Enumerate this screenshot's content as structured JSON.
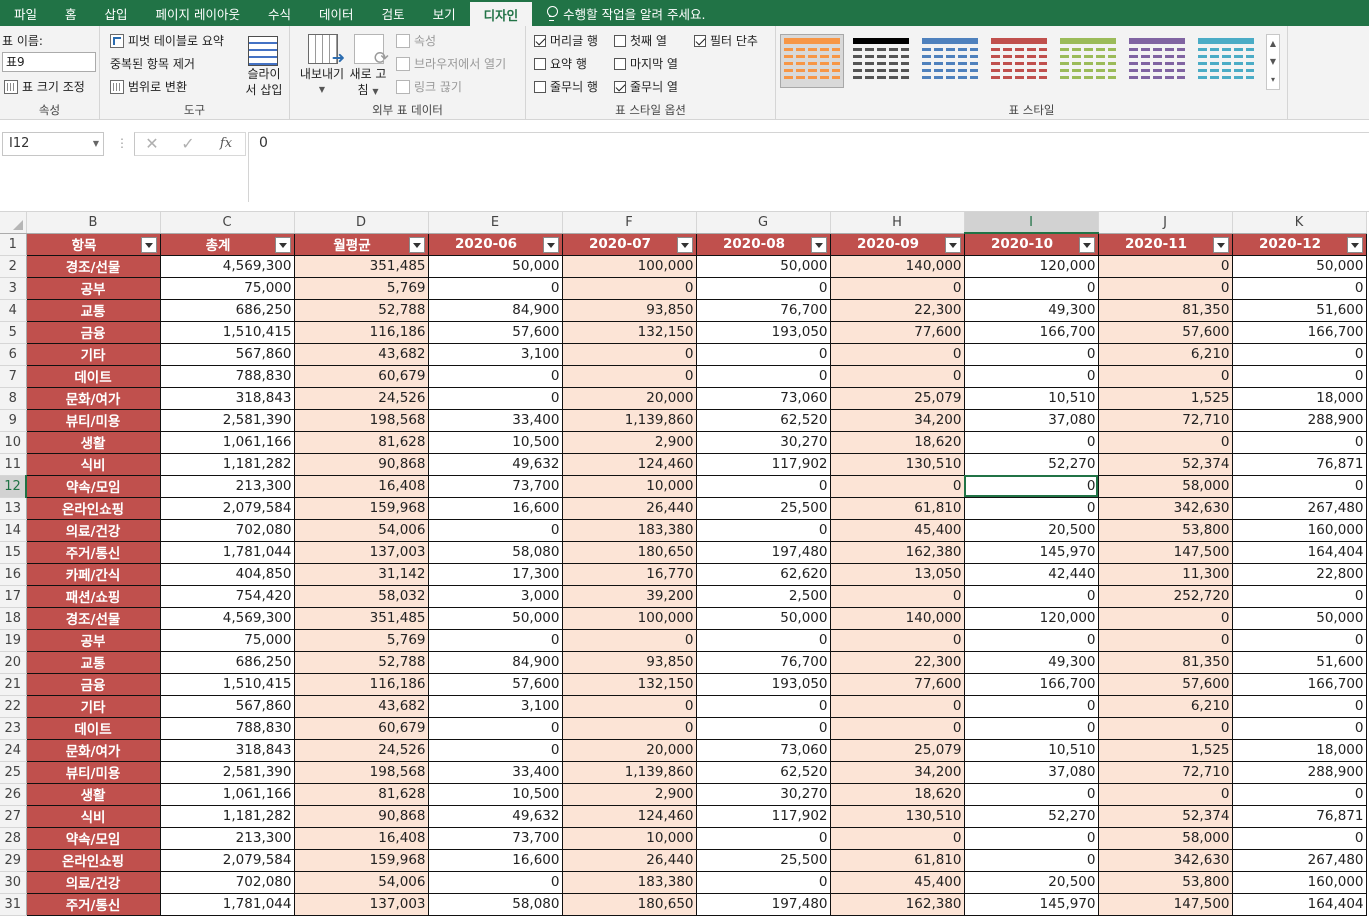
{
  "ribbon": {
    "tabs": [
      "파일",
      "홈",
      "삽입",
      "페이지 레이아웃",
      "수식",
      "데이터",
      "검토",
      "보기",
      "디자인"
    ],
    "active_tab": "디자인",
    "tell_me": "수행할 작업을 알려 주세요.",
    "properties": {
      "table_name_label": "표 이름:",
      "table_name_value": "표9",
      "resize_table": "표 크기 조정",
      "group_label": "속성"
    },
    "tools": {
      "summarize_pivot": "피벗 테이블로 요약",
      "remove_duplicates": "중복된 항목 제거",
      "convert_to_range": "범위로 변환",
      "insert_slicer": "슬라이서 삽입",
      "insert_slicer_line1": "슬라이",
      "insert_slicer_line2": "서 삽입",
      "group_label": "도구"
    },
    "external": {
      "export": "내보내기",
      "refresh_line1": "새로 고",
      "refresh_line2": "침",
      "properties": "속성",
      "open_in_browser": "브라우저에서 열기",
      "unlink": "링크 끊기",
      "group_label": "외부 표 데이터"
    },
    "style_options": {
      "header_row": "머리글 행",
      "total_row": "요약 행",
      "banded_rows": "줄무늬 행",
      "first_column": "첫째 열",
      "last_column": "마지막 열",
      "banded_columns": "줄무늬 열",
      "filter_button": "필터 단추",
      "header_row_checked": true,
      "total_row_checked": false,
      "banded_rows_checked": false,
      "first_column_checked": false,
      "last_column_checked": false,
      "banded_columns_checked": true,
      "filter_button_checked": true,
      "group_label": "표 스타일 옵션"
    },
    "table_styles": {
      "group_label": "표 스타일",
      "swatch_colors": [
        "#f79646",
        "#000000",
        "#4f81bd",
        "#c0504d",
        "#9bbb59",
        "#8064a2",
        "#4bacc6"
      ]
    }
  },
  "formula_bar": {
    "name_box": "I12",
    "cancel_icon": "✕",
    "enter_icon": "✓",
    "fx_label": "fx",
    "value": "0"
  },
  "sheet": {
    "columns": [
      "B",
      "C",
      "D",
      "E",
      "F",
      "G",
      "H",
      "I",
      "J",
      "K"
    ],
    "selected_column": "I",
    "selected_row": 12,
    "headers": [
      "항목",
      "총계",
      "월평균",
      "2020-06",
      "2020-07",
      "2020-08",
      "2020-09",
      "2020-10",
      "2020-11",
      "2020-12"
    ],
    "rows": [
      {
        "n": 2,
        "cells": [
          "경조/선물",
          "4,569,300",
          "351,485",
          "50,000",
          "100,000",
          "50,000",
          "140,000",
          "120,000",
          "0",
          "50,000"
        ]
      },
      {
        "n": 3,
        "cells": [
          "공부",
          "75,000",
          "5,769",
          "0",
          "0",
          "0",
          "0",
          "0",
          "0",
          "0"
        ]
      },
      {
        "n": 4,
        "cells": [
          "교통",
          "686,250",
          "52,788",
          "84,900",
          "93,850",
          "76,700",
          "22,300",
          "49,300",
          "81,350",
          "51,600"
        ]
      },
      {
        "n": 5,
        "cells": [
          "금융",
          "1,510,415",
          "116,186",
          "57,600",
          "132,150",
          "193,050",
          "77,600",
          "166,700",
          "57,600",
          "166,700"
        ]
      },
      {
        "n": 6,
        "cells": [
          "기타",
          "567,860",
          "43,682",
          "3,100",
          "0",
          "0",
          "0",
          "0",
          "6,210",
          "0"
        ]
      },
      {
        "n": 7,
        "cells": [
          "데이트",
          "788,830",
          "60,679",
          "0",
          "0",
          "0",
          "0",
          "0",
          "0",
          "0"
        ]
      },
      {
        "n": 8,
        "cells": [
          "문화/여가",
          "318,843",
          "24,526",
          "0",
          "20,000",
          "73,060",
          "25,079",
          "10,510",
          "1,525",
          "18,000"
        ]
      },
      {
        "n": 9,
        "cells": [
          "뷰티/미용",
          "2,581,390",
          "198,568",
          "33,400",
          "1,139,860",
          "62,520",
          "34,200",
          "37,080",
          "72,710",
          "288,900"
        ]
      },
      {
        "n": 10,
        "cells": [
          "생활",
          "1,061,166",
          "81,628",
          "10,500",
          "2,900",
          "30,270",
          "18,620",
          "0",
          "0",
          "0"
        ]
      },
      {
        "n": 11,
        "cells": [
          "식비",
          "1,181,282",
          "90,868",
          "49,632",
          "124,460",
          "117,902",
          "130,510",
          "52,270",
          "52,374",
          "76,871"
        ]
      },
      {
        "n": 12,
        "cells": [
          "약속/모임",
          "213,300",
          "16,408",
          "73,700",
          "10,000",
          "0",
          "0",
          "0",
          "58,000",
          "0"
        ]
      },
      {
        "n": 13,
        "cells": [
          "온라인쇼핑",
          "2,079,584",
          "159,968",
          "16,600",
          "26,440",
          "25,500",
          "61,810",
          "0",
          "342,630",
          "267,480"
        ]
      },
      {
        "n": 14,
        "cells": [
          "의료/건강",
          "702,080",
          "54,006",
          "0",
          "183,380",
          "0",
          "45,400",
          "20,500",
          "53,800",
          "160,000"
        ]
      },
      {
        "n": 15,
        "cells": [
          "주거/통신",
          "1,781,044",
          "137,003",
          "58,080",
          "180,650",
          "197,480",
          "162,380",
          "145,970",
          "147,500",
          "164,404"
        ]
      },
      {
        "n": 16,
        "cells": [
          "카페/간식",
          "404,850",
          "31,142",
          "17,300",
          "16,770",
          "62,620",
          "13,050",
          "42,440",
          "11,300",
          "22,800"
        ]
      },
      {
        "n": 17,
        "cells": [
          "패션/쇼핑",
          "754,420",
          "58,032",
          "3,000",
          "39,200",
          "2,500",
          "0",
          "0",
          "252,720",
          "0"
        ]
      },
      {
        "n": 18,
        "cells": [
          "경조/선물",
          "4,569,300",
          "351,485",
          "50,000",
          "100,000",
          "50,000",
          "140,000",
          "120,000",
          "0",
          "50,000"
        ]
      },
      {
        "n": 19,
        "cells": [
          "공부",
          "75,000",
          "5,769",
          "0",
          "0",
          "0",
          "0",
          "0",
          "0",
          "0"
        ]
      },
      {
        "n": 20,
        "cells": [
          "교통",
          "686,250",
          "52,788",
          "84,900",
          "93,850",
          "76,700",
          "22,300",
          "49,300",
          "81,350",
          "51,600"
        ]
      },
      {
        "n": 21,
        "cells": [
          "금융",
          "1,510,415",
          "116,186",
          "57,600",
          "132,150",
          "193,050",
          "77,600",
          "166,700",
          "57,600",
          "166,700"
        ]
      },
      {
        "n": 22,
        "cells": [
          "기타",
          "567,860",
          "43,682",
          "3,100",
          "0",
          "0",
          "0",
          "0",
          "6,210",
          "0"
        ]
      },
      {
        "n": 23,
        "cells": [
          "데이트",
          "788,830",
          "60,679",
          "0",
          "0",
          "0",
          "0",
          "0",
          "0",
          "0"
        ]
      },
      {
        "n": 24,
        "cells": [
          "문화/여가",
          "318,843",
          "24,526",
          "0",
          "20,000",
          "73,060",
          "25,079",
          "10,510",
          "1,525",
          "18,000"
        ]
      },
      {
        "n": 25,
        "cells": [
          "뷰티/미용",
          "2,581,390",
          "198,568",
          "33,400",
          "1,139,860",
          "62,520",
          "34,200",
          "37,080",
          "72,710",
          "288,900"
        ]
      },
      {
        "n": 26,
        "cells": [
          "생활",
          "1,061,166",
          "81,628",
          "10,500",
          "2,900",
          "30,270",
          "18,620",
          "0",
          "0",
          "0"
        ]
      },
      {
        "n": 27,
        "cells": [
          "식비",
          "1,181,282",
          "90,868",
          "49,632",
          "124,460",
          "117,902",
          "130,510",
          "52,270",
          "52,374",
          "76,871"
        ]
      },
      {
        "n": 28,
        "cells": [
          "약속/모임",
          "213,300",
          "16,408",
          "73,700",
          "10,000",
          "0",
          "0",
          "0",
          "58,000",
          "0"
        ]
      },
      {
        "n": 29,
        "cells": [
          "온라인쇼핑",
          "2,079,584",
          "159,968",
          "16,600",
          "26,440",
          "25,500",
          "61,810",
          "0",
          "342,630",
          "267,480"
        ]
      },
      {
        "n": 30,
        "cells": [
          "의료/건강",
          "702,080",
          "54,006",
          "0",
          "183,380",
          "0",
          "45,400",
          "20,500",
          "53,800",
          "160,000"
        ]
      },
      {
        "n": 31,
        "cells": [
          "주거/통신",
          "1,781,044",
          "137,003",
          "58,080",
          "180,650",
          "197,480",
          "162,380",
          "145,970",
          "147,500",
          "164,404"
        ]
      }
    ],
    "colors": {
      "header_fill": "#c0504d",
      "band_fill": "#fce4d6",
      "selection": "#217346"
    }
  }
}
